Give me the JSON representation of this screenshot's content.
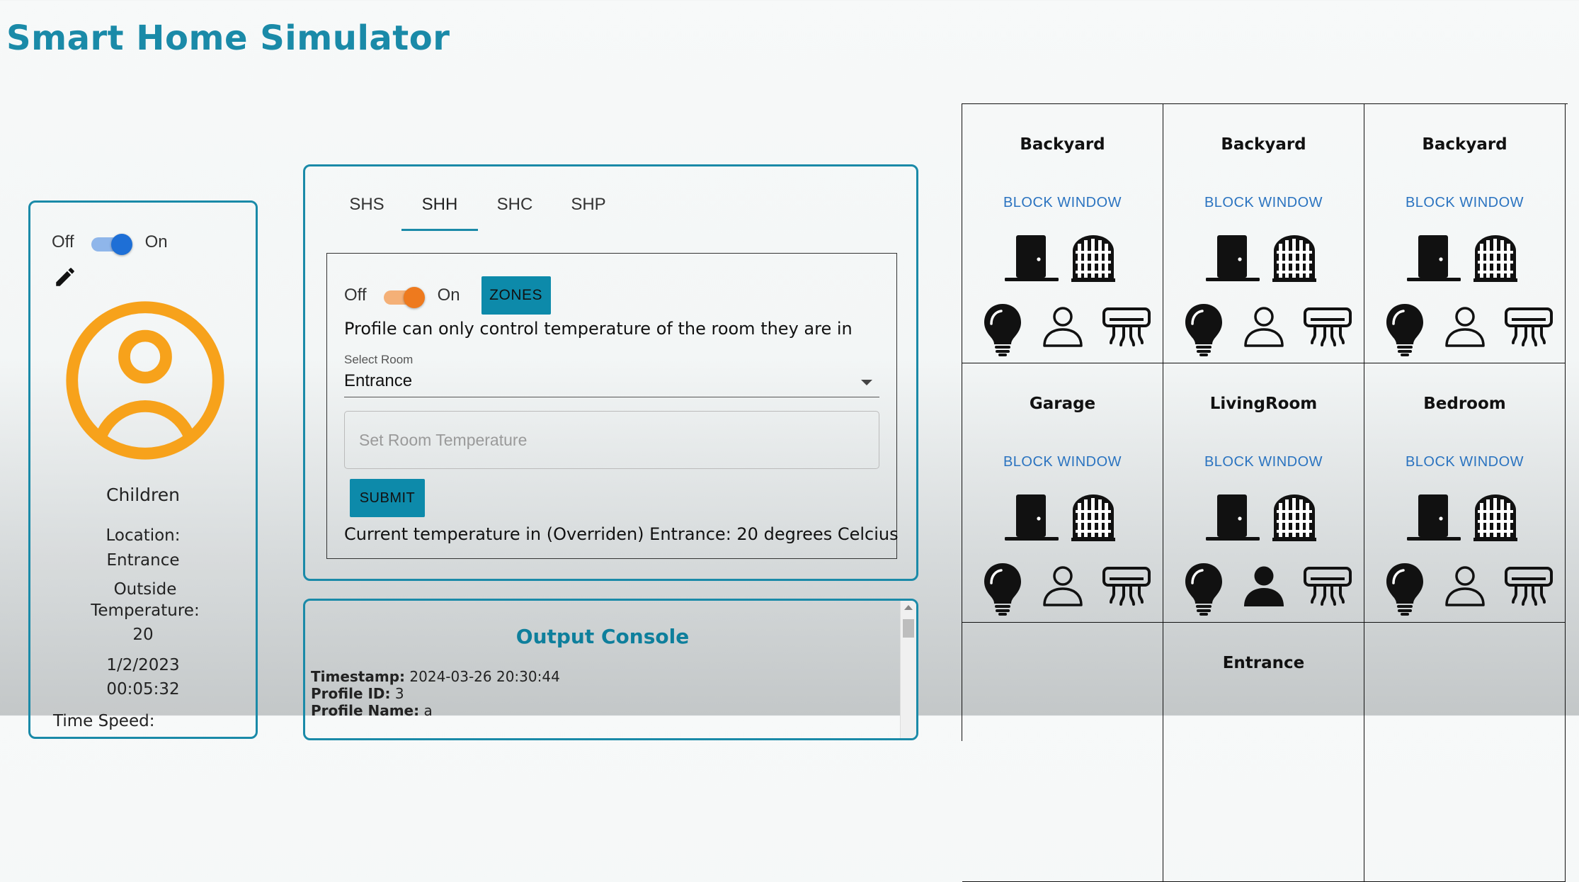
{
  "app": {
    "title": "Smart Home Simulator"
  },
  "profile": {
    "off_label": "Off",
    "on_label": "On",
    "name": "Children",
    "location_label": "Location:",
    "location_value": "Entrance",
    "outside_temp_label": "Outside Temperature:",
    "outside_temp_value": "20",
    "date": "1/2/2023",
    "time": "00:05:32",
    "speed_label": "Time Speed:"
  },
  "control": {
    "tabs": [
      {
        "label": "SHS"
      },
      {
        "label": "SHH",
        "active": true
      },
      {
        "label": "SHC"
      },
      {
        "label": "SHP"
      }
    ],
    "shh": {
      "off_label": "Off",
      "on_label": "On",
      "zones_label": "ZONES",
      "note": "Profile can only control temperature of the room they are in",
      "select_label": "Select Room",
      "selected_room": "Entrance",
      "temp_placeholder": "Set Room Temperature",
      "submit_label": "SUBMIT",
      "current_temp": "Current temperature in (Overriden) Entrance: 20 degrees Celcius"
    }
  },
  "console": {
    "title": "Output Console",
    "timestamp_label": "Timestamp:",
    "timestamp_value": "2024-03-26 20:30:44",
    "profile_id_label": "Profile ID:",
    "profile_id_value": "3",
    "profile_name_label": "Profile Name:",
    "profile_name_value": "a"
  },
  "rooms": [
    {
      "name": "Backyard",
      "action": "BLOCK WINDOW",
      "occupied": false
    },
    {
      "name": "Backyard",
      "action": "BLOCK WINDOW",
      "occupied": false
    },
    {
      "name": "Backyard",
      "action": "BLOCK WINDOW",
      "occupied": false
    },
    {
      "name": "Garage",
      "action": "BLOCK WINDOW",
      "occupied": false
    },
    {
      "name": "LivingRoom",
      "action": "BLOCK WINDOW",
      "occupied": true
    },
    {
      "name": "Bedroom",
      "action": "BLOCK WINDOW",
      "occupied": false
    },
    {
      "name": "",
      "action": ""
    },
    {
      "name": "Entrance",
      "action": ""
    },
    {
      "name": "",
      "action": ""
    }
  ],
  "colors": {
    "accent": "#1a8aa8",
    "button": "#0d8aaa",
    "avatar": "#f7a21b",
    "toggle_blue": "#1e6fd6",
    "toggle_orange": "#ee7a1e",
    "link": "#2a73c0"
  },
  "icons": [
    "pencil-icon",
    "avatar-icon",
    "door-icon",
    "window-icon",
    "lightbulb-icon",
    "person-icon",
    "air-conditioner-icon",
    "dropdown-caret-icon"
  ]
}
